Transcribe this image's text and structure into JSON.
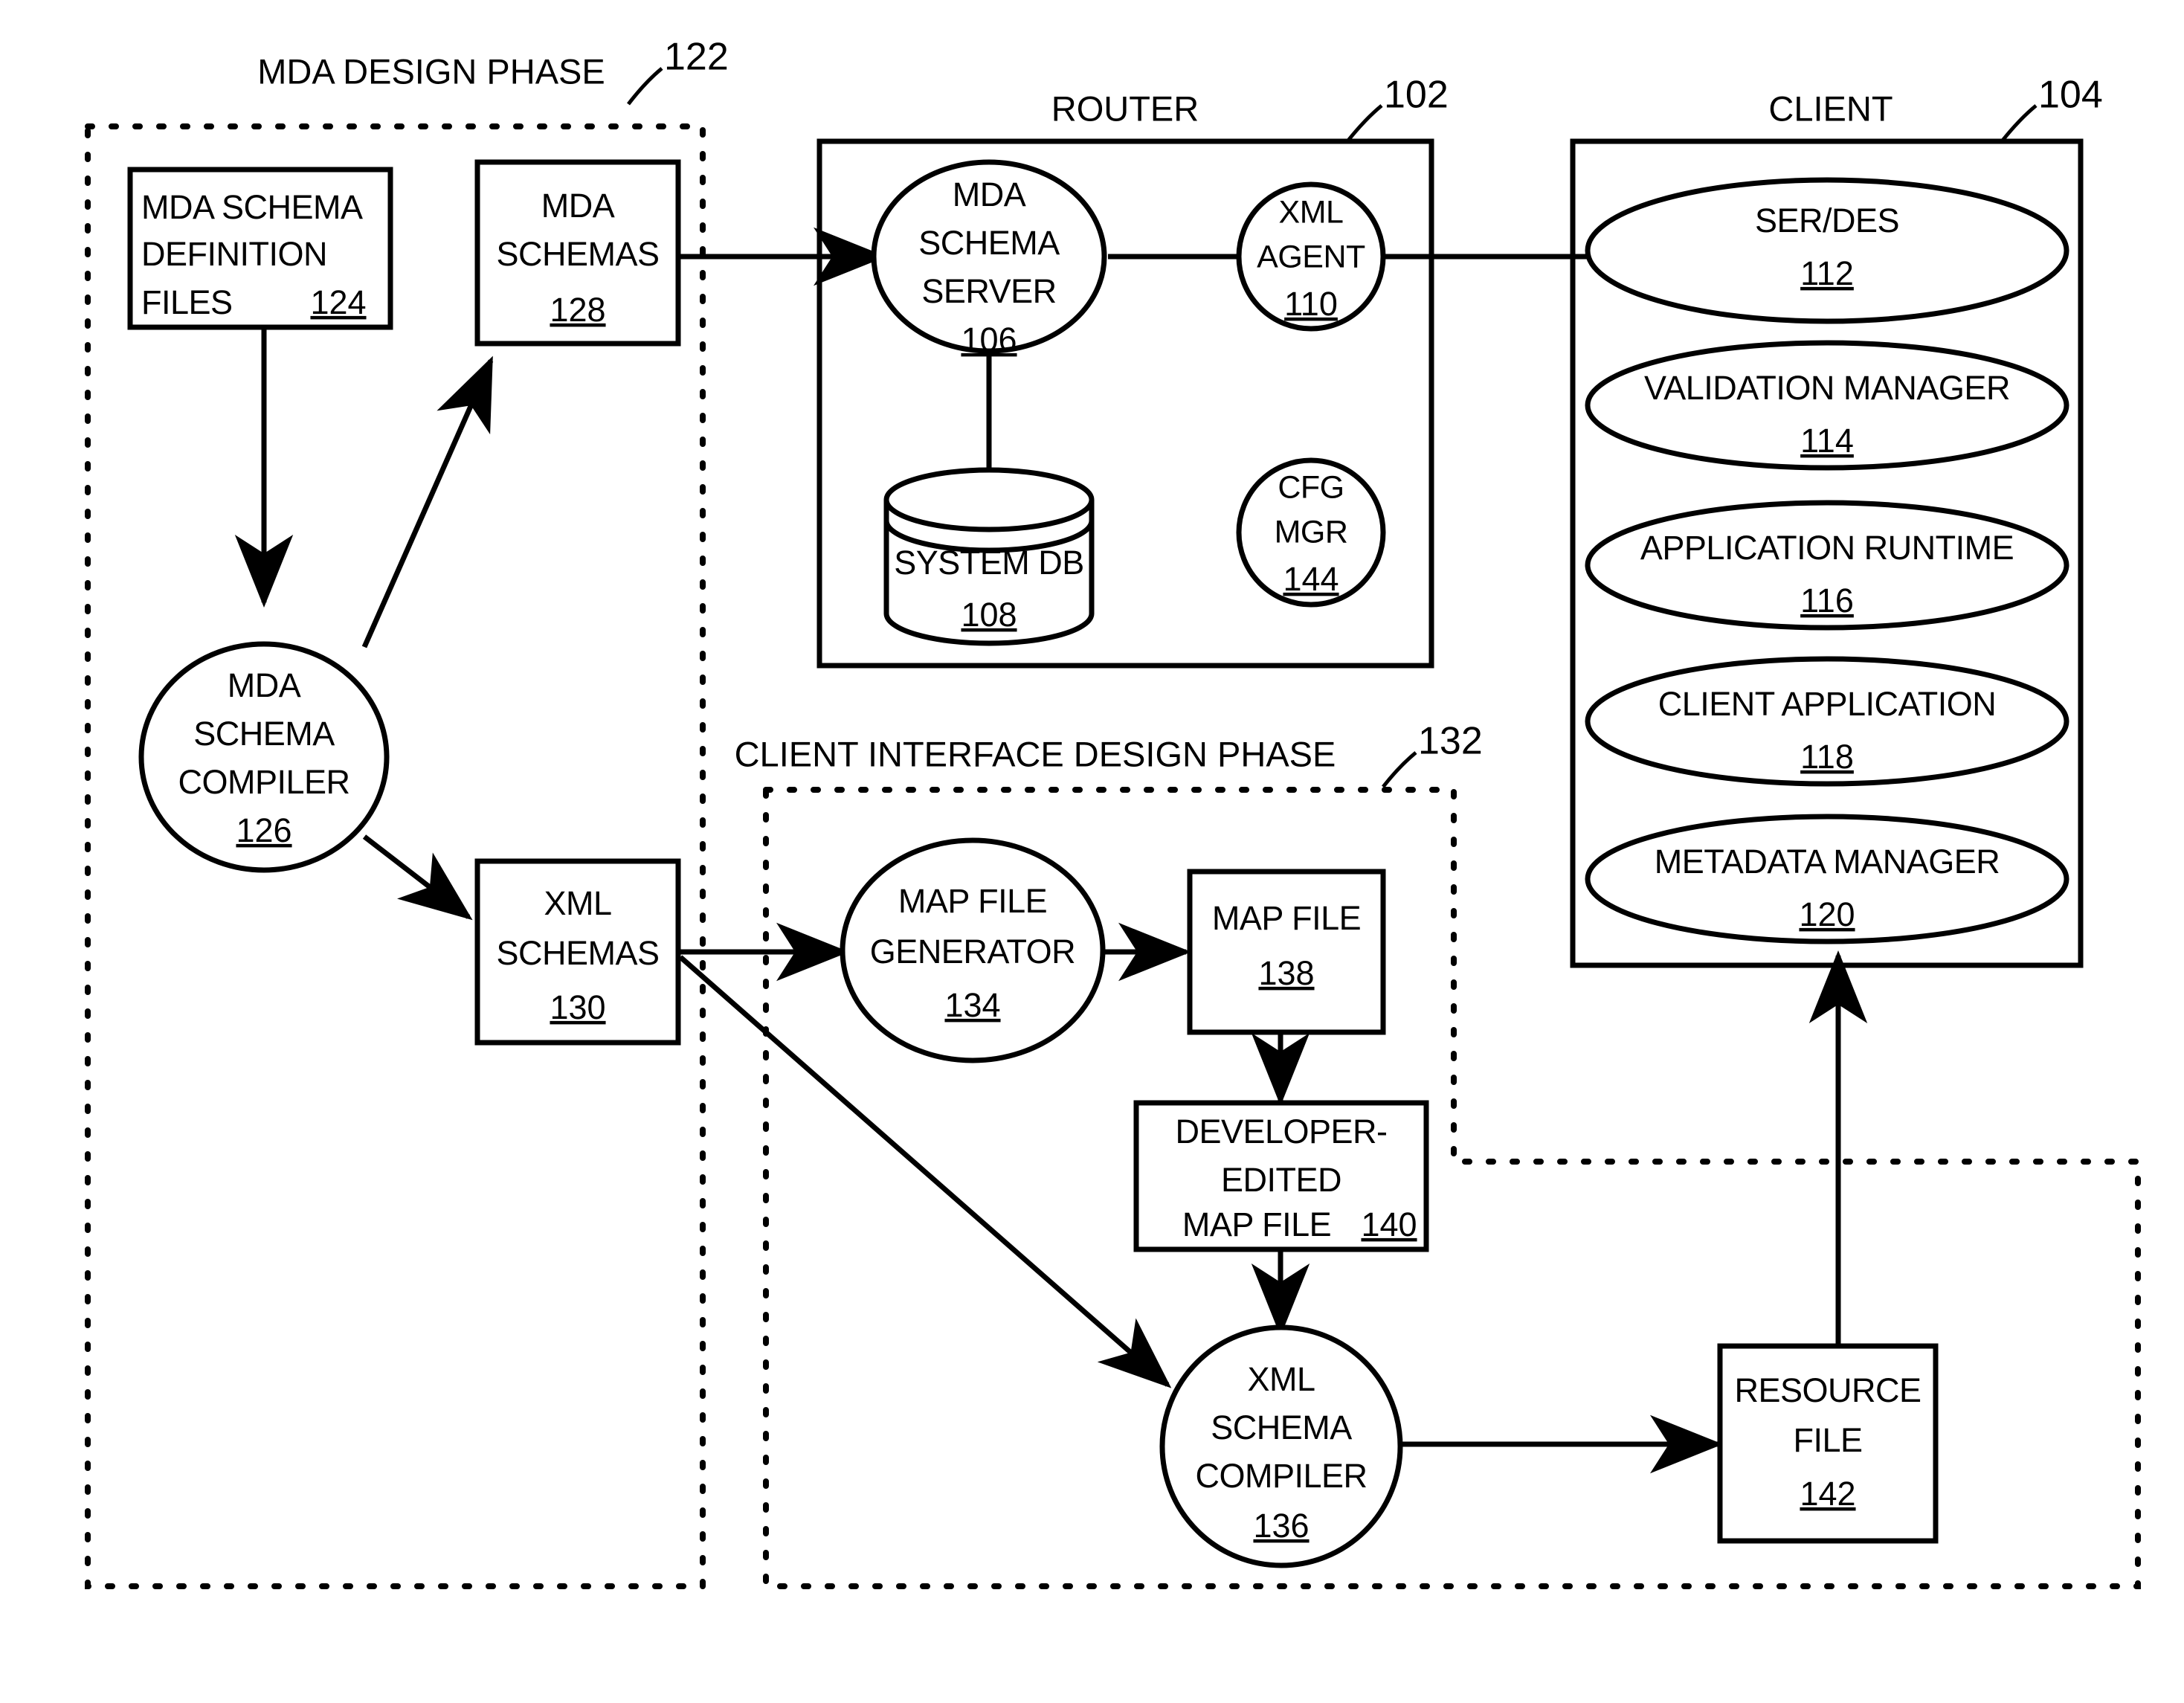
{
  "figure": {
    "title": "MDA schema / XML schema compilation system block diagram"
  },
  "groups": [
    {
      "id": "mda-design-phase",
      "label": "MDA  DESIGN PHASE",
      "ref": "122"
    },
    {
      "id": "client-interface-design-phase",
      "label": "CLIENT INTERFACE DESIGN PHASE",
      "ref": "132"
    }
  ],
  "containers": [
    {
      "id": "router",
      "label": "ROUTER",
      "ref": "102"
    },
    {
      "id": "client",
      "label": "CLIENT",
      "ref": "104"
    }
  ],
  "nodes": {
    "mda_schema_definition_files": {
      "lines": [
        "MDA SCHEMA",
        "DEFINITION",
        "FILES"
      ],
      "ref": "124",
      "shape": "rect"
    },
    "mda_schemas": {
      "lines": [
        "MDA",
        "SCHEMAS"
      ],
      "ref": "128",
      "shape": "rect"
    },
    "mda_schema_compiler": {
      "lines": [
        "MDA",
        "SCHEMA",
        "COMPILER"
      ],
      "ref": "126",
      "shape": "circle"
    },
    "xml_schemas": {
      "lines": [
        "XML",
        "SCHEMAS"
      ],
      "ref": "130",
      "shape": "rect"
    },
    "mda_schema_server": {
      "lines": [
        "MDA",
        "SCHEMA",
        "SERVER"
      ],
      "ref": "106",
      "shape": "circle"
    },
    "system_db": {
      "lines": [
        "SYSTEM DB"
      ],
      "ref": "108",
      "shape": "cylinder"
    },
    "xml_agent": {
      "lines": [
        "XML",
        "AGENT"
      ],
      "ref": "110",
      "shape": "circle"
    },
    "cfg_mgr": {
      "lines": [
        "CFG",
        "MGR"
      ],
      "ref": "144",
      "shape": "circle"
    },
    "ser_des": {
      "lines": [
        "SER/DES"
      ],
      "ref": "112",
      "shape": "ellipse"
    },
    "validation_manager": {
      "lines": [
        "VALIDATION MANAGER"
      ],
      "ref": "114",
      "shape": "ellipse"
    },
    "application_runtime": {
      "lines": [
        "APPLICATION RUNTIME"
      ],
      "ref": "116",
      "shape": "ellipse"
    },
    "client_application": {
      "lines": [
        "CLIENT APPLICATION"
      ],
      "ref": "118",
      "shape": "ellipse"
    },
    "metadata_manager": {
      "lines": [
        "METADATA MANAGER"
      ],
      "ref": "120",
      "shape": "ellipse"
    },
    "map_file_generator": {
      "lines": [
        "MAP FILE",
        "GENERATOR"
      ],
      "ref": "134",
      "shape": "ellipse"
    },
    "map_file": {
      "lines": [
        "MAP FILE"
      ],
      "ref": "138",
      "shape": "rect"
    },
    "developer_edited_map_file": {
      "lines": [
        "DEVELOPER-",
        "EDITED",
        "MAP FILE"
      ],
      "ref": "140",
      "shape": "rect",
      "ref_inline": true
    },
    "xml_schema_compiler": {
      "lines": [
        "XML",
        "SCHEMA",
        "COMPILER"
      ],
      "ref": "136",
      "shape": "ellipse"
    },
    "resource_file": {
      "lines": [
        "RESOURCE",
        "FILE"
      ],
      "ref": "142",
      "shape": "rect"
    }
  },
  "colors": {
    "line": "#000000",
    "fill": "#ffffff"
  }
}
